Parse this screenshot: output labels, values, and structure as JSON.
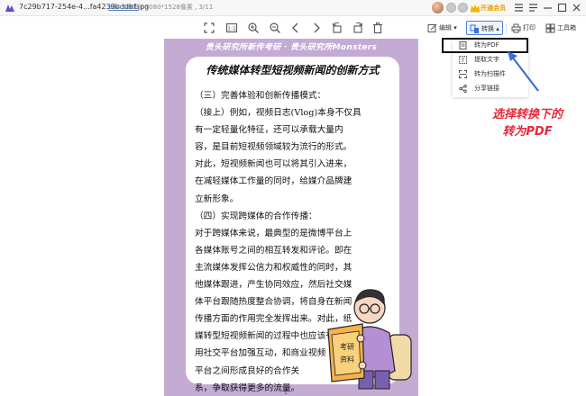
{
  "titlebar": {
    "file_name": "7c29b717-254e-4...fa4239bddbf.jpg",
    "file_size": "364.38KB",
    "dimensions": "1080*1528像素",
    "page_counter": "3/11",
    "vip_label": "开通会员",
    "icons": [
      "app-logo",
      "avatar",
      "status-dot",
      "status-dot",
      "vip-crown",
      "menu-icon",
      "list-icon",
      "minimize-icon",
      "maximize-icon",
      "close-icon"
    ]
  },
  "toolbar": {
    "tools": [
      "fit-page-icon",
      "fullscreen-icon",
      "actual-size-icon",
      "zoom-in-icon",
      "zoom-out-icon",
      "previous-icon",
      "next-icon",
      "rotate-left-icon",
      "rotate-right-icon",
      "delete-icon"
    ],
    "edit_label": "编辑",
    "convert_label": "转换",
    "print_label": "打印",
    "toolbox_label": "工具箱"
  },
  "dropdown": {
    "items": [
      {
        "label": "转为PDF",
        "icon": "pdf-icon"
      },
      {
        "label": "提取文字",
        "icon": "text-extract-icon"
      },
      {
        "label": "转为扫描件",
        "icon": "scan-icon"
      },
      {
        "label": "分享链接",
        "icon": "share-link-icon"
      }
    ]
  },
  "annotation": {
    "line1": "选择转换下的",
    "line2": "转为PDF",
    "color": "#e8283a"
  },
  "document": {
    "header": "贵头研究所新传考研 · 贵头研究所Monsters",
    "title": "传统媒体转型短视频新闻的创新方式",
    "lines": [
      "（三）完善体验和创新传播模式：",
      "（接上）例如，视频日志(Vlog)本身不仅具",
      "有一定轻量化特征，还可以承载大量内",
      "容，是目前短视频领域较为流行的形式。",
      "对此，短视频新闻也可以将其引入进来，",
      "在减轻媒体工作量的同时，给媒介品牌建",
      "立新形象。",
      "（四）实现跨媒体的合作传播：",
      "对于跨媒体来说，最典型的是微博平台上",
      "各媒体账号之间的相互转发和评论。即在",
      "主流媒体发挥公信力和权威性的同时，其",
      "他媒体跟进，产生协同效应，然后社交媒",
      "体平台跟随热度整合协调，将自身在新闻",
      "传播方面的作用完全发挥出来。对此，纸",
      "媒转型短视频新闻的过程中也应该有效利",
      "用社交平台加强互动，和商业视频",
      "平台之间形成良好的合作关",
      "系，争取获得更多的流量。"
    ],
    "sign_text": "考研资料",
    "page_indicator": "1",
    "accent_color": "#c3abd4"
  }
}
